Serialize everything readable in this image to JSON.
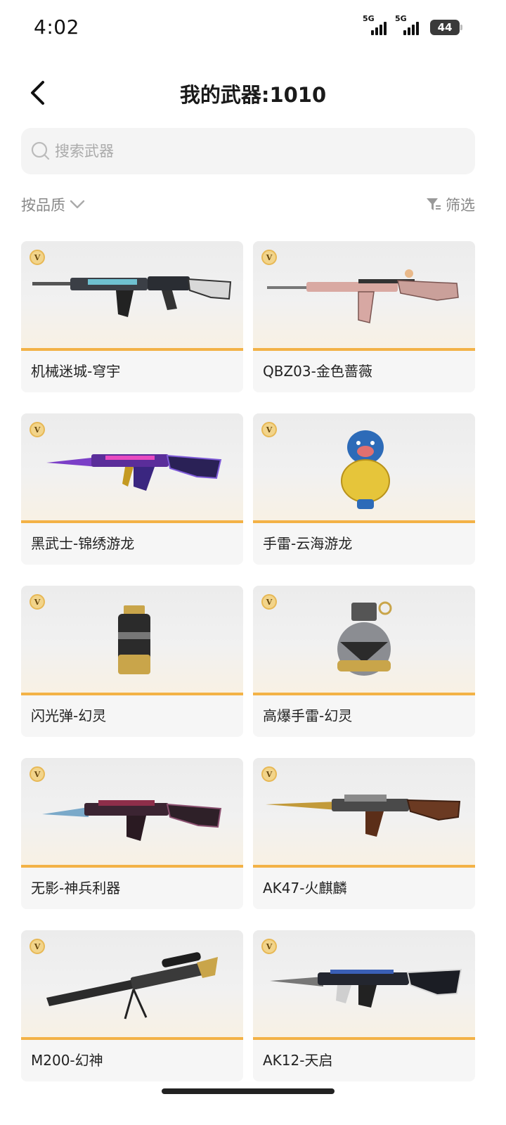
{
  "status": {
    "time": "4:02",
    "sim1": "5G",
    "sim2": "5G",
    "battery": "44"
  },
  "header": {
    "title": "我的武器:1010"
  },
  "search": {
    "placeholder": "搜索武器",
    "value": ""
  },
  "sort": {
    "label": "按品质"
  },
  "filter": {
    "label": "筛选"
  },
  "badge_label": "V",
  "colors": {
    "accent": "#f3b246",
    "badge": "#f2d48a",
    "card_bg": "#f6f6f6"
  },
  "weapons": [
    {
      "name": "机械迷城-穹宇",
      "icon": "rifle-icon"
    },
    {
      "name": "QBZ03-金色蔷薇",
      "icon": "rifle-icon"
    },
    {
      "name": "黑武士-锦绣游龙",
      "icon": "rifle-icon"
    },
    {
      "name": "手雷-云海游龙",
      "icon": "grenade-figure-icon"
    },
    {
      "name": "闪光弹-幻灵",
      "icon": "flashbang-icon"
    },
    {
      "name": "高爆手雷-幻灵",
      "icon": "grenade-icon"
    },
    {
      "name": "无影-神兵利器",
      "icon": "rifle-icon"
    },
    {
      "name": "AK47-火麒麟",
      "icon": "rifle-icon"
    },
    {
      "name": "M200-幻神",
      "icon": "sniper-icon"
    },
    {
      "name": "AK12-天启",
      "icon": "rifle-icon"
    }
  ]
}
